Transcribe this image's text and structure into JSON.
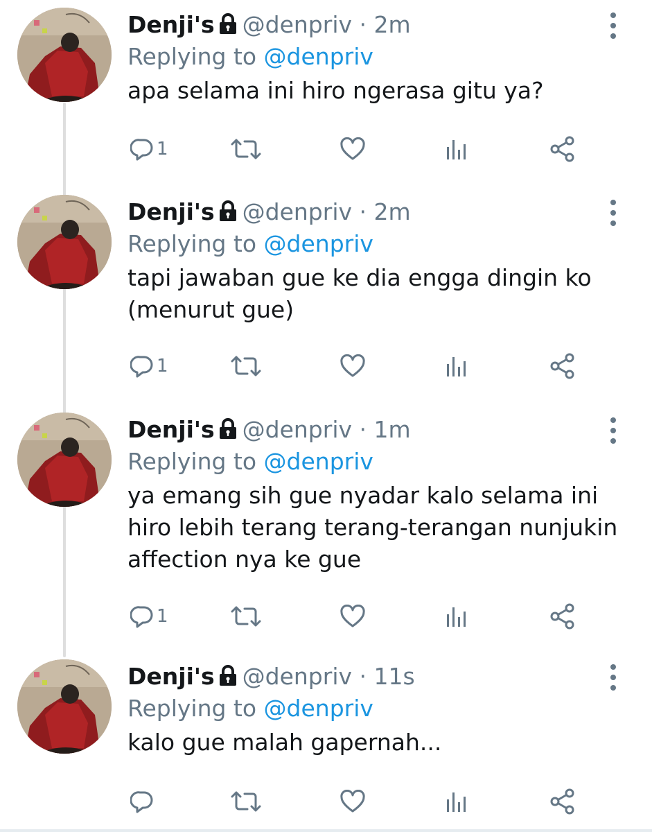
{
  "colors": {
    "text": "#14171a",
    "muted": "#657786",
    "link": "#1b95e0",
    "thread_line": "#dedede"
  },
  "tweets": [
    {
      "display_name": "Denji's",
      "handle": "@denpriv",
      "dot": "·",
      "time": "2m",
      "replying_prefix": "Replying to",
      "replying_handle": "@denpriv",
      "text": "apa selama ini hiro ngerasa gitu ya?",
      "reply_count": "1"
    },
    {
      "display_name": "Denji's",
      "handle": "@denpriv",
      "dot": "·",
      "time": "2m",
      "replying_prefix": "Replying to",
      "replying_handle": "@denpriv",
      "text": "tapi jawaban gue ke dia engga dingin ko (menurut gue)",
      "reply_count": "1"
    },
    {
      "display_name": "Denji's",
      "handle": "@denpriv",
      "dot": "·",
      "time": "1m",
      "replying_prefix": "Replying to",
      "replying_handle": "@denpriv",
      "text": "ya emang sih gue nyadar kalo selama ini hiro lebih terang terang-terangan nunjukin affection nya ke gue",
      "reply_count": "1"
    },
    {
      "display_name": "Denji's",
      "handle": "@denpriv",
      "dot": "·",
      "time": "11s",
      "replying_prefix": "Replying to",
      "replying_handle": "@denpriv",
      "text": "kalo gue malah gapernah...",
      "reply_count": ""
    }
  ],
  "icons": {
    "protected": "lock-icon",
    "more": "more-vertical-icon",
    "reply": "reply-icon",
    "retweet": "retweet-icon",
    "like": "heart-icon",
    "analytics": "analytics-icon",
    "share": "share-icon"
  }
}
